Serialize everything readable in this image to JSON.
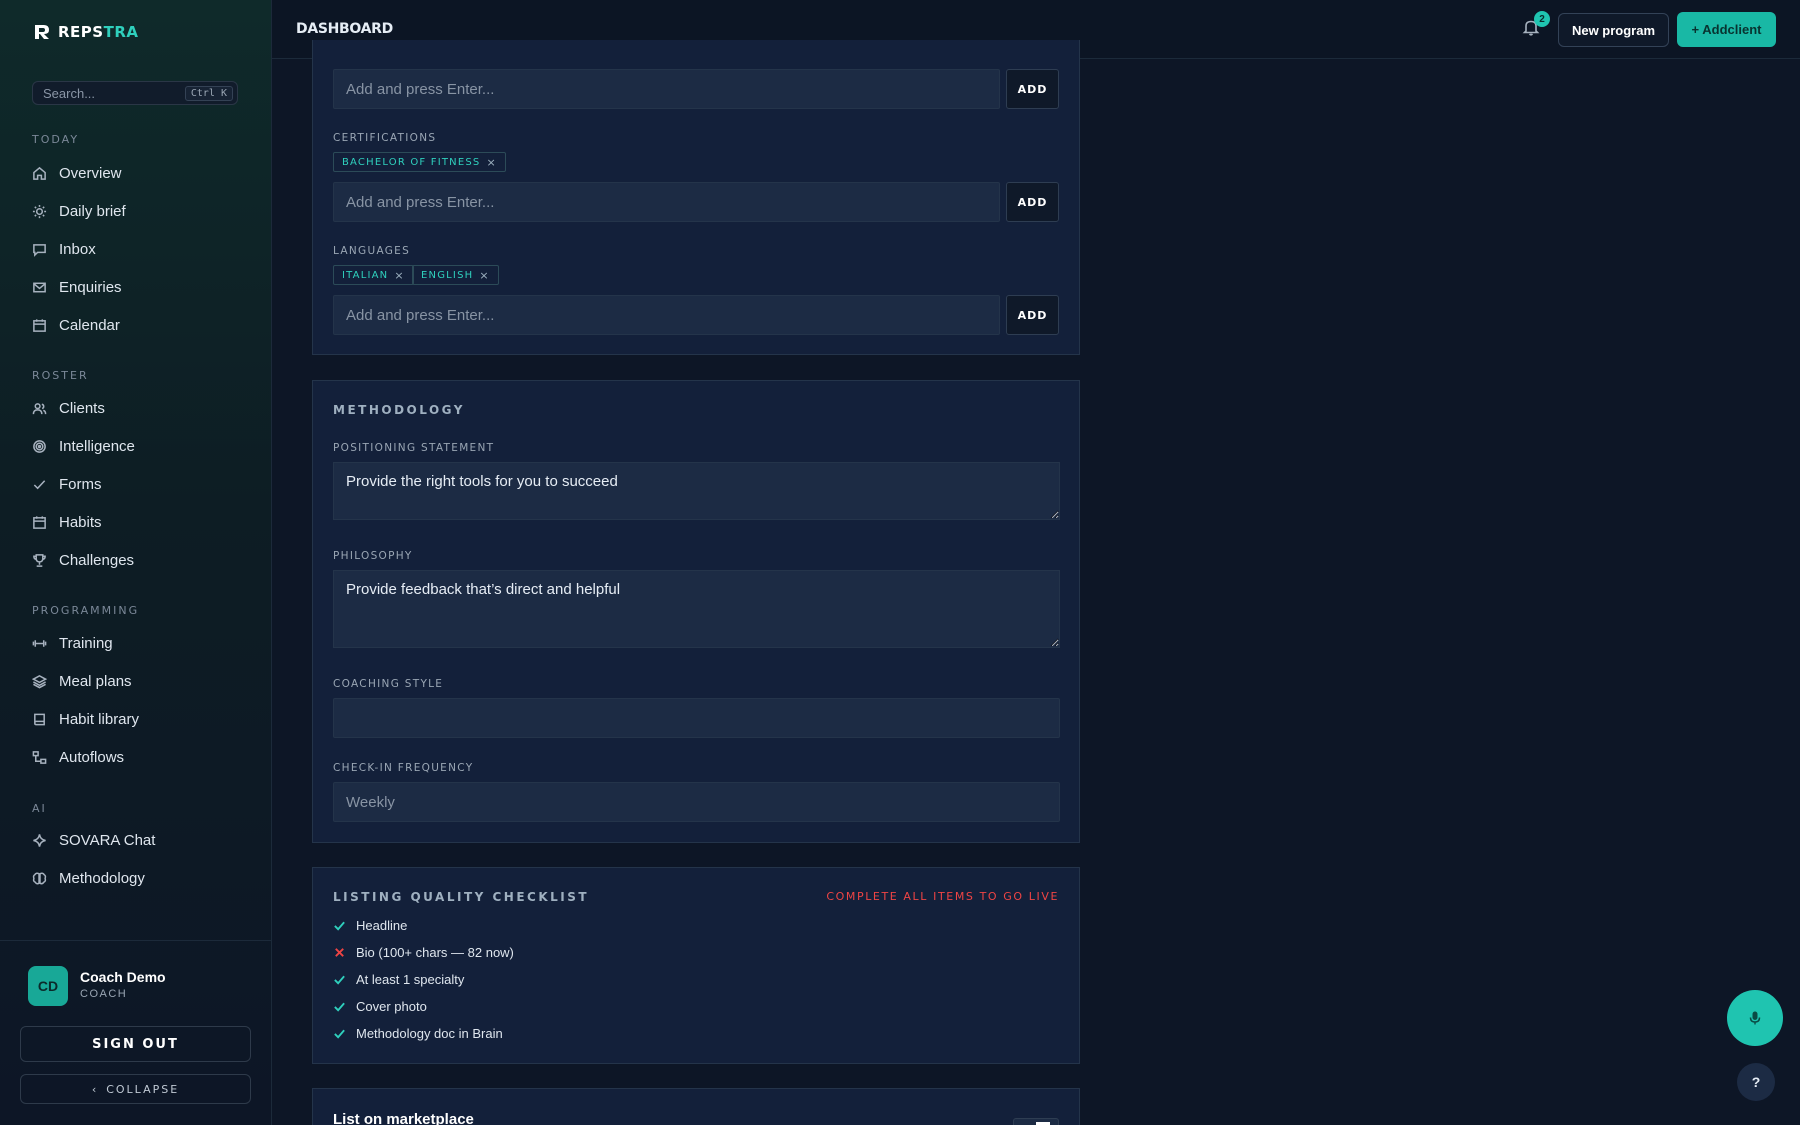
{
  "brand": {
    "name_part1": "REPS",
    "name_part2": "TRA"
  },
  "search": {
    "placeholder": "Search...",
    "shortcut": "Ctrl K"
  },
  "nav": {
    "sections": [
      {
        "title": "TODAY",
        "items": [
          "Overview",
          "Daily brief",
          "Inbox",
          "Enquiries",
          "Calendar"
        ]
      },
      {
        "title": "ROSTER",
        "items": [
          "Clients",
          "Intelligence",
          "Forms",
          "Habits",
          "Challenges"
        ]
      },
      {
        "title": "PROGRAMMING",
        "items": [
          "Training",
          "Meal plans",
          "Habit library",
          "Autoflows"
        ]
      },
      {
        "title": "AI",
        "items": [
          "SOVARA Chat",
          "Methodology"
        ]
      }
    ]
  },
  "profile": {
    "initials": "CD",
    "name": "Coach Demo",
    "role": "COACH",
    "sign_out": "SIGN OUT",
    "collapse": "COLLAPSE"
  },
  "header": {
    "title": "DASHBOARD",
    "notifications": "2",
    "new_program": "New program",
    "add_client": "+ Addclient"
  },
  "credentials": {
    "input_placeholder": "Add and press Enter...",
    "add_label": "ADD",
    "certifications_label": "CERTIFICATIONS",
    "certifications": [
      "BACHELOR OF FITNESS"
    ],
    "languages_label": "LANGUAGES",
    "languages": [
      "ITALIAN",
      "ENGLISH"
    ],
    "tag_remove": "×"
  },
  "methodology": {
    "heading": "METHODOLOGY",
    "positioning_label": "POSITIONING STATEMENT",
    "positioning_value": "Provide the right tools for you to succeed",
    "philosophy_label": "PHILOSOPHY",
    "philosophy_value": "Provide feedback that’s direct and helpful",
    "coaching_style_label": "COACHING STYLE",
    "coaching_style_value": "",
    "checkin_label": "CHECK-IN FREQUENCY",
    "checkin_placeholder": "Weekly"
  },
  "checklist": {
    "heading": "LISTING QUALITY CHECKLIST",
    "warning": "COMPLETE ALL ITEMS TO GO LIVE",
    "items": [
      {
        "label": "Headline",
        "status": "done"
      },
      {
        "label": "Bio (100+ chars — 82 now)",
        "status": "missing"
      },
      {
        "label": "At least 1 specialty",
        "status": "done"
      },
      {
        "label": "Cover photo",
        "status": "done"
      },
      {
        "label": "Methodology doc in Brain",
        "status": "done"
      }
    ]
  },
  "marketplace": {
    "title": "List on marketplace"
  },
  "help": {
    "label": "?"
  },
  "colors": {
    "accent": "#1fc4b0",
    "danger": "#ef4444",
    "bg": "#0d1626",
    "card": "#13203a"
  }
}
